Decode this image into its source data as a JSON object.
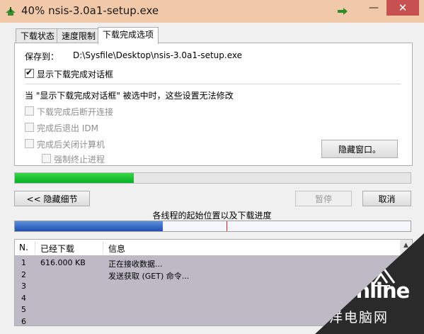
{
  "window": {
    "title": "40% nsis-3.0a1-setup.exe",
    "minimize_glyph": "—",
    "close_glyph": "✕"
  },
  "tabs": [
    {
      "label": "下载状态",
      "active": false
    },
    {
      "label": "速度限制",
      "active": false
    },
    {
      "label": "下载完成选项",
      "active": true
    }
  ],
  "completion": {
    "save_to_label": "保存到：",
    "save_to_path": "D:\\Sysfile\\Desktop\\nsis-3.0a1-setup.exe",
    "show_dialog_label": "显示下载完成对话框",
    "show_dialog_checked": true,
    "notice": "当 \"显示下载完成对话框\" 被选中时，这些设置无法修改",
    "options": [
      {
        "label": "下载完成后断开连接",
        "enabled": false
      },
      {
        "label": "完成后退出 IDM",
        "enabled": false
      },
      {
        "label": "完成后关闭计算机",
        "enabled": false
      },
      {
        "label": "强制终止进程",
        "enabled": false
      }
    ],
    "hide_window_label": "隐藏窗口。"
  },
  "progress": {
    "fraction": 0.3
  },
  "buttons": {
    "hide_details": "<< 隐藏细节",
    "pause": "暂停",
    "cancel": "取消"
  },
  "connections": {
    "label": "各线程的起始位置以及下载进度",
    "fill_fraction": 0.373,
    "marker_fraction": 0.535
  },
  "threads": {
    "headers": [
      "N.",
      "已经下载",
      "信息"
    ],
    "rows": [
      {
        "n": "1",
        "downloaded": "616.000 KB",
        "info": "正在接收数据..."
      },
      {
        "n": "2",
        "downloaded": "",
        "info": "发送获取 (GET) 命令..."
      },
      {
        "n": "3",
        "downloaded": "",
        "info": ""
      },
      {
        "n": "4",
        "downloaded": "",
        "info": ""
      },
      {
        "n": "5",
        "downloaded": "",
        "info": ""
      },
      {
        "n": "6",
        "downloaded": "",
        "info": ""
      }
    ]
  },
  "watermark": {
    "brand": "PConline",
    "subtitle": "太平洋电脑网"
  },
  "colors": {
    "titlebar": "#f2c9a8",
    "close_button": "#c75050",
    "progress_green": "#06b025",
    "connection_blue": "#1f4fb0",
    "thread_rows_bg": "#bdbac6"
  }
}
